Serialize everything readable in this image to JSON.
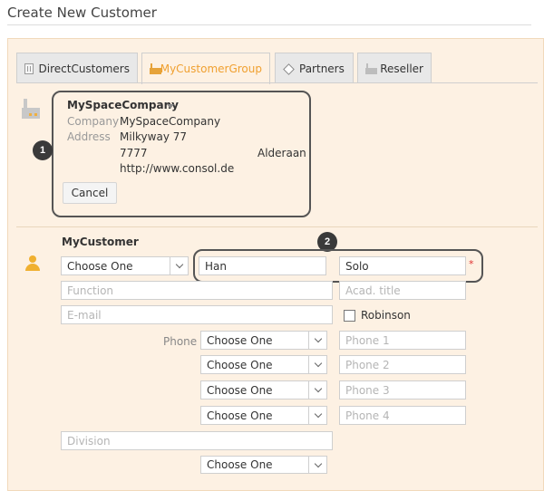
{
  "page": {
    "title": "Create New Customer"
  },
  "tabs": [
    {
      "label": "DirectCustomers",
      "icon": "building-icon",
      "active": false
    },
    {
      "label": "MyCustomerGroup",
      "icon": "factory-icon",
      "active": true
    },
    {
      "label": "Partners",
      "icon": "diamond-icon",
      "active": false
    },
    {
      "label": "Reseller",
      "icon": "factory-icon",
      "active": false
    }
  ],
  "company": {
    "name": "MySpaceCompany",
    "company_label": "Company",
    "company_value": "MySpaceCompany",
    "address_label": "Address",
    "street": "Milkyway 77",
    "zip": "7777",
    "city": "Alderaan",
    "url": "http://www.consol.de",
    "cancel_label": "Cancel"
  },
  "callouts": {
    "one": "1",
    "two": "2"
  },
  "customer": {
    "section_title": "MyCustomer",
    "salutation": "Choose One",
    "first_name": "Han",
    "last_name": "Solo",
    "required_mark": "*",
    "function_placeholder": "Function",
    "acad_title_placeholder": "Acad. title",
    "email_placeholder": "E-mail",
    "checkbox_label": "Robinson",
    "phone_label": "Phone",
    "phones": [
      {
        "type": "Choose One",
        "placeholder": "Phone 1"
      },
      {
        "type": "Choose One",
        "placeholder": "Phone 2"
      },
      {
        "type": "Choose One",
        "placeholder": "Phone 3"
      },
      {
        "type": "Choose One",
        "placeholder": "Phone 4"
      }
    ],
    "division_placeholder": "Division",
    "bottom_select": "Choose One"
  }
}
